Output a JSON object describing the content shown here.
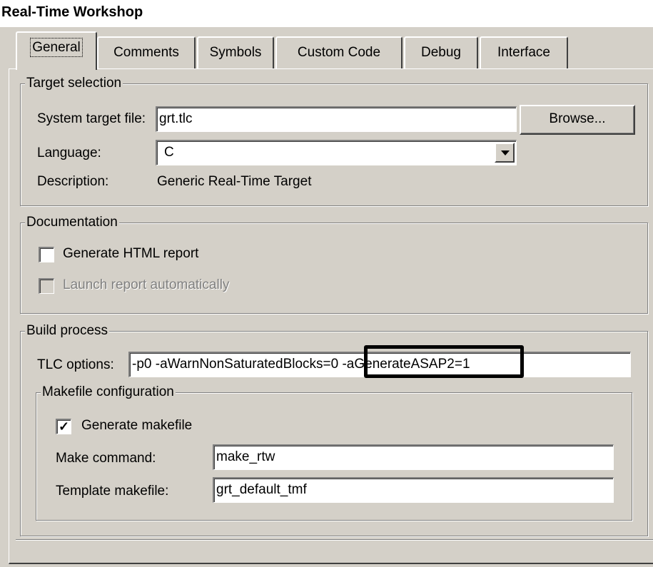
{
  "window": {
    "title": "Real-Time Workshop"
  },
  "tabs": [
    {
      "label": "General",
      "active": true
    },
    {
      "label": "Comments",
      "active": false
    },
    {
      "label": "Symbols",
      "active": false
    },
    {
      "label": "Custom Code",
      "active": false
    },
    {
      "label": "Debug",
      "active": false
    },
    {
      "label": "Interface",
      "active": false
    }
  ],
  "target_selection": {
    "legend": "Target selection",
    "system_target_file_label": "System target file:",
    "system_target_file_value": "grt.tlc",
    "browse_label": "Browse...",
    "language_label": "Language:",
    "language_value": "C",
    "description_label": "Description:",
    "description_value": "Generic Real-Time Target"
  },
  "documentation": {
    "legend": "Documentation",
    "generate_html_label": "Generate HTML report",
    "generate_html_checked": false,
    "launch_report_label": "Launch report automatically",
    "launch_report_checked": false
  },
  "build_process": {
    "legend": "Build process",
    "tlc_options_label": "TLC options:",
    "tlc_options_value": "-p0 -aWarnNonSaturatedBlocks=0 -aGenerateASAP2=1",
    "highlighted_option": "-aGenerateASAP2=1",
    "makefile": {
      "legend": "Makefile configuration",
      "generate_makefile_label": "Generate makefile",
      "generate_makefile_checked": true,
      "make_command_label": "Make command:",
      "make_command_value": "make_rtw",
      "template_makefile_label": "Template makefile:",
      "template_makefile_value": "grt_default_tmf"
    }
  },
  "icons": {
    "dropdown": "chevron-down-icon",
    "check": "checkmark-icon"
  }
}
